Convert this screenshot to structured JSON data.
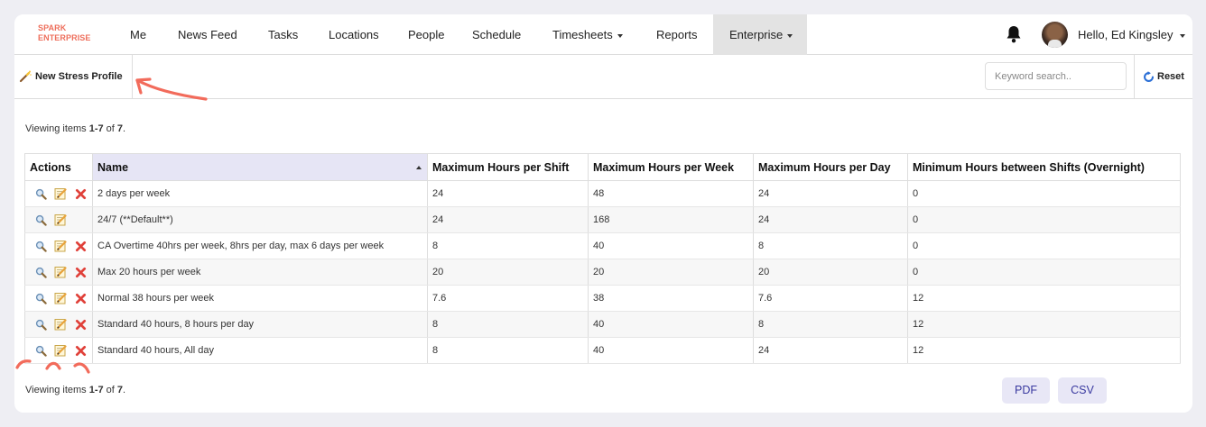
{
  "brand": {
    "line1": "SPARK",
    "line2": "ENTERPRISE",
    "color": "#ee6f5c"
  },
  "nav": {
    "items": [
      {
        "label": "Me"
      },
      {
        "label": "News Feed"
      },
      {
        "label": "Tasks"
      },
      {
        "label": "Locations"
      },
      {
        "label": "People"
      },
      {
        "label": "Schedule"
      },
      {
        "label": "Timesheets",
        "dropdown": true
      },
      {
        "label": "Reports"
      },
      {
        "label": "Enterprise",
        "dropdown": true,
        "active": true
      }
    ],
    "greeting": "Hello, Ed Kingsley",
    "bell_icon": "bell-icon"
  },
  "toolbar": {
    "new_label": "New Stress Profile",
    "new_icon": "magic-wand-icon",
    "search_placeholder": "Keyword search..",
    "reset_label": "Reset",
    "reset_icon": "refresh-icon"
  },
  "summary": {
    "prefix": "Viewing items ",
    "range": "1-7",
    "middle": " of ",
    "total": "7",
    "suffix": "."
  },
  "table": {
    "columns": [
      "Actions",
      "Name",
      "Maximum Hours per Shift",
      "Maximum Hours per Week",
      "Maximum Hours per Day",
      "Minimum Hours between Shifts (Overnight)"
    ],
    "sorted_column": "Name",
    "rows": [
      {
        "name": "2 days per week",
        "shift": "24",
        "week": "48",
        "day": "24",
        "between": "0",
        "deletable": true
      },
      {
        "name": "24/7 (**Default**)",
        "shift": "24",
        "week": "168",
        "day": "24",
        "between": "0",
        "deletable": false
      },
      {
        "name": "CA Overtime 40hrs per week, 8hrs per day, max 6 days per week",
        "shift": "8",
        "week": "40",
        "day": "8",
        "between": "0",
        "deletable": true
      },
      {
        "name": "Max 20 hours per week",
        "shift": "20",
        "week": "20",
        "day": "20",
        "between": "0",
        "deletable": true
      },
      {
        "name": "Normal 38 hours per week",
        "shift": "7.6",
        "week": "38",
        "day": "7.6",
        "between": "12",
        "deletable": true
      },
      {
        "name": "Standard 40 hours, 8 hours per day",
        "shift": "8",
        "week": "40",
        "day": "8",
        "between": "12",
        "deletable": true
      },
      {
        "name": "Standard 40 hours, All day",
        "shift": "8",
        "week": "40",
        "day": "24",
        "between": "12",
        "deletable": true
      }
    ],
    "row_action_icons": [
      "view-magnifier-icon",
      "edit-pencil-icon",
      "delete-x-icon"
    ]
  },
  "export": {
    "pdf_label": "PDF",
    "csv_label": "CSV"
  },
  "colors": {
    "accent": "#e8e7f6",
    "accent_text": "#3a3aa0",
    "annotation": "#f26b5b",
    "delete": "#e0413a"
  }
}
